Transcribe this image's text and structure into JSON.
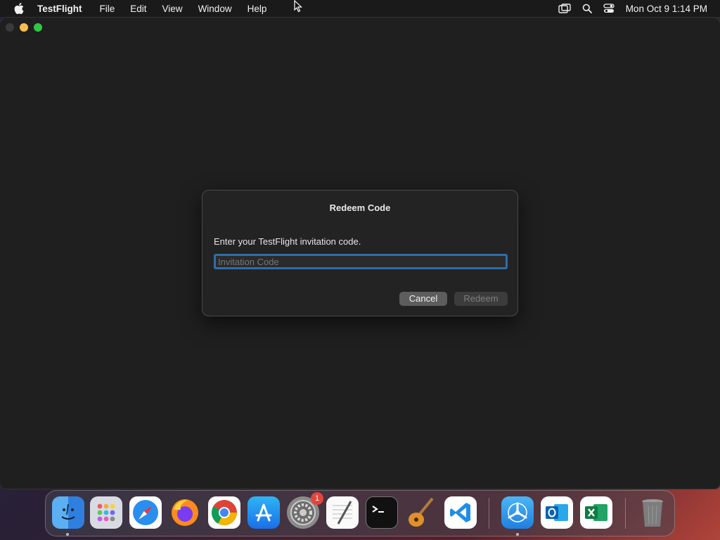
{
  "menubar": {
    "app_name": "TestFlight",
    "items": [
      "File",
      "Edit",
      "View",
      "Window",
      "Help"
    ],
    "clock": "Mon Oct 9  1:14 PM",
    "status_icons": [
      "screen-mirroring-icon",
      "spotlight-search-icon",
      "control-center-icon"
    ]
  },
  "dialog": {
    "title": "Redeem Code",
    "prompt": "Enter your TestFlight invitation code.",
    "input_placeholder": "Invitation Code",
    "input_value": "",
    "cancel_label": "Cancel",
    "redeem_label": "Redeem"
  },
  "dock": {
    "items": [
      {
        "name": "finder",
        "icon": "finder-icon"
      },
      {
        "name": "launchpad",
        "icon": "launchpad-icon"
      },
      {
        "name": "safari",
        "icon": "safari-icon"
      },
      {
        "name": "firefox",
        "icon": "firefox-icon"
      },
      {
        "name": "chrome",
        "icon": "chrome-icon"
      },
      {
        "name": "app-store",
        "icon": "app-store-icon"
      },
      {
        "name": "system-settings",
        "icon": "gear-icon",
        "badge": "1"
      },
      {
        "name": "textedit",
        "icon": "textedit-icon"
      },
      {
        "name": "terminal",
        "icon": "terminal-icon"
      },
      {
        "name": "garageband",
        "icon": "guitar-icon"
      },
      {
        "name": "vscode",
        "icon": "vscode-icon"
      },
      {
        "name": "testflight",
        "icon": "testflight-icon"
      },
      {
        "name": "outlook",
        "icon": "outlook-icon"
      },
      {
        "name": "excel",
        "icon": "excel-icon"
      },
      {
        "name": "trash",
        "icon": "trash-icon"
      }
    ]
  },
  "colors": {
    "accent": "#2f6ea8",
    "window_bg": "#1f1f1f",
    "dialog_bg": "#232323"
  }
}
